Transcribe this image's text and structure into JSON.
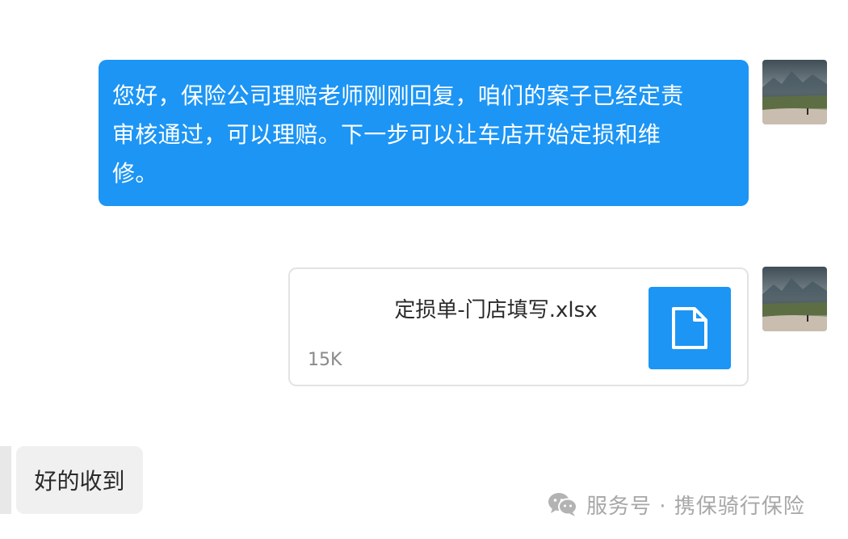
{
  "messages": [
    {
      "type": "text",
      "direction": "sent",
      "lines": [
        "您好，保险公司理赔老师刚刚回复，咱们的案子已经定责",
        "审核通过，可以理赔。下一步可以让车店开始定损和维",
        "修。"
      ]
    },
    {
      "type": "file",
      "direction": "sent",
      "file_name": "定损单-门店填写.xlsx",
      "file_size": "15K",
      "icon": "document-icon"
    },
    {
      "type": "text",
      "direction": "received",
      "text": "好的收到"
    }
  ],
  "watermark": {
    "icon": "wechat-icon",
    "text": "服务号 · 携保骑行保险"
  },
  "colors": {
    "sent_bubble": "#1c95f5",
    "received_bubble": "#f0f0f0",
    "file_icon_bg": "#1c95f5"
  }
}
